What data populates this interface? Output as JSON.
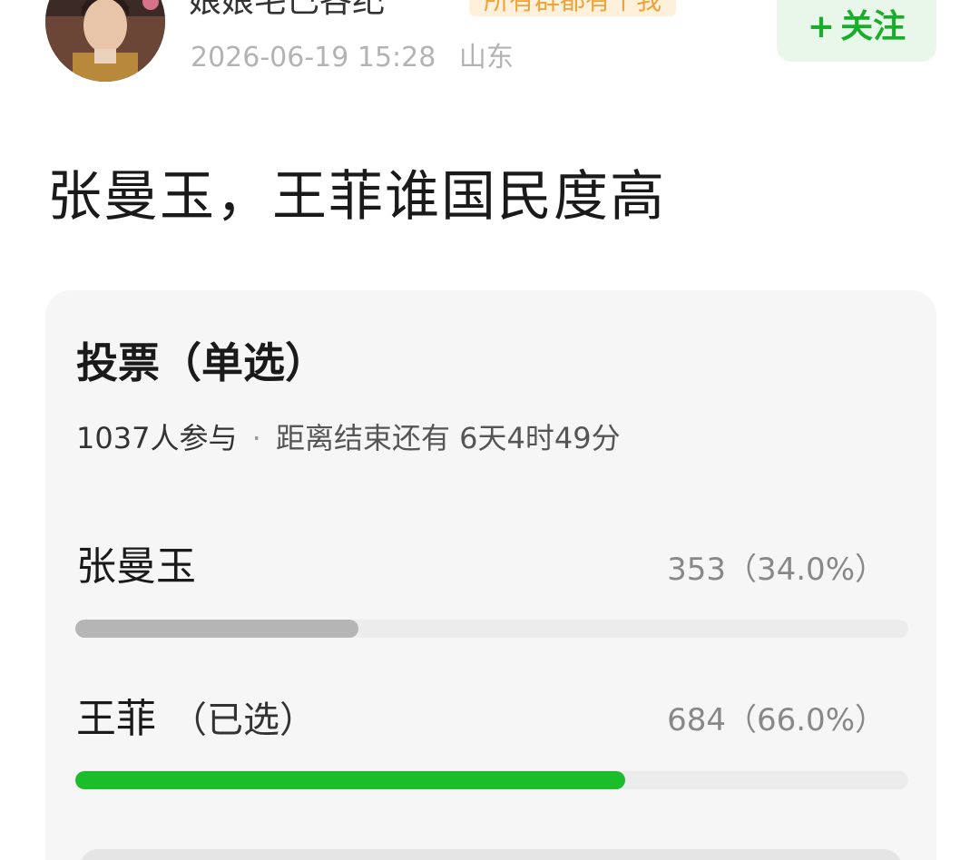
{
  "user": {
    "name": "娘娘宅已各纪",
    "member_tag": "所有群都有个我",
    "timestamp": "2026-06-19 15:28",
    "location": "山东"
  },
  "follow_button": {
    "plus": "+",
    "label": "关注"
  },
  "post": {
    "title": "张曼玉，王菲谁国民度高"
  },
  "poll": {
    "heading": "投票（单选）",
    "participants": "1037人参与",
    "separator": "·",
    "remaining": "距离结束还有 6天4时49分",
    "options": [
      {
        "name": "张曼玉",
        "chosen_label": "",
        "count": "353（34.0%）",
        "fraction": 0.34,
        "bar_color": "#b5b5b5"
      },
      {
        "name": "王菲",
        "chosen_label": "（已选）",
        "count": "684（66.0%）",
        "fraction": 0.66,
        "bar_color": "#1cbd2a"
      }
    ]
  },
  "colors": {
    "accent_green": "#19ae2a",
    "follow_bg": "#e9f7ea",
    "tag_text": "#f0a23a",
    "tag_bg": "#fdf1dc",
    "card_bg": "#f6f6f6"
  }
}
